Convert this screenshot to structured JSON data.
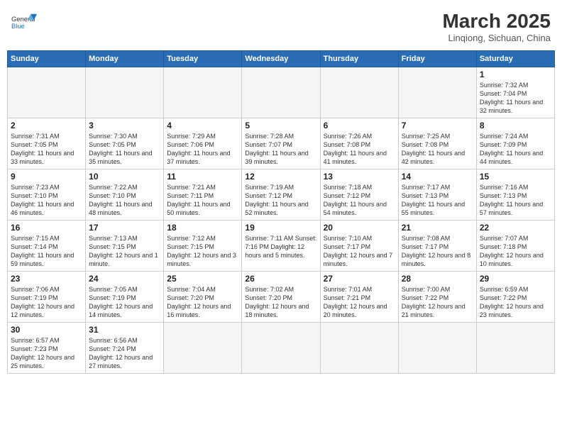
{
  "header": {
    "logo_general": "General",
    "logo_blue": "Blue",
    "month_year": "March 2025",
    "location": "Linqiong, Sichuan, China"
  },
  "days_of_week": [
    "Sunday",
    "Monday",
    "Tuesday",
    "Wednesday",
    "Thursday",
    "Friday",
    "Saturday"
  ],
  "weeks": [
    [
      {
        "num": "",
        "info": ""
      },
      {
        "num": "",
        "info": ""
      },
      {
        "num": "",
        "info": ""
      },
      {
        "num": "",
        "info": ""
      },
      {
        "num": "",
        "info": ""
      },
      {
        "num": "",
        "info": ""
      },
      {
        "num": "1",
        "info": "Sunrise: 7:32 AM\nSunset: 7:04 PM\nDaylight: 11 hours and 32 minutes."
      }
    ],
    [
      {
        "num": "2",
        "info": "Sunrise: 7:31 AM\nSunset: 7:05 PM\nDaylight: 11 hours and 33 minutes."
      },
      {
        "num": "3",
        "info": "Sunrise: 7:30 AM\nSunset: 7:05 PM\nDaylight: 11 hours and 35 minutes."
      },
      {
        "num": "4",
        "info": "Sunrise: 7:29 AM\nSunset: 7:06 PM\nDaylight: 11 hours and 37 minutes."
      },
      {
        "num": "5",
        "info": "Sunrise: 7:28 AM\nSunset: 7:07 PM\nDaylight: 11 hours and 39 minutes."
      },
      {
        "num": "6",
        "info": "Sunrise: 7:26 AM\nSunset: 7:08 PM\nDaylight: 11 hours and 41 minutes."
      },
      {
        "num": "7",
        "info": "Sunrise: 7:25 AM\nSunset: 7:08 PM\nDaylight: 11 hours and 42 minutes."
      },
      {
        "num": "8",
        "info": "Sunrise: 7:24 AM\nSunset: 7:09 PM\nDaylight: 11 hours and 44 minutes."
      }
    ],
    [
      {
        "num": "9",
        "info": "Sunrise: 7:23 AM\nSunset: 7:10 PM\nDaylight: 11 hours and 46 minutes."
      },
      {
        "num": "10",
        "info": "Sunrise: 7:22 AM\nSunset: 7:10 PM\nDaylight: 11 hours and 48 minutes."
      },
      {
        "num": "11",
        "info": "Sunrise: 7:21 AM\nSunset: 7:11 PM\nDaylight: 11 hours and 50 minutes."
      },
      {
        "num": "12",
        "info": "Sunrise: 7:19 AM\nSunset: 7:12 PM\nDaylight: 11 hours and 52 minutes."
      },
      {
        "num": "13",
        "info": "Sunrise: 7:18 AM\nSunset: 7:12 PM\nDaylight: 11 hours and 54 minutes."
      },
      {
        "num": "14",
        "info": "Sunrise: 7:17 AM\nSunset: 7:13 PM\nDaylight: 11 hours and 55 minutes."
      },
      {
        "num": "15",
        "info": "Sunrise: 7:16 AM\nSunset: 7:13 PM\nDaylight: 11 hours and 57 minutes."
      }
    ],
    [
      {
        "num": "16",
        "info": "Sunrise: 7:15 AM\nSunset: 7:14 PM\nDaylight: 11 hours and 59 minutes."
      },
      {
        "num": "17",
        "info": "Sunrise: 7:13 AM\nSunset: 7:15 PM\nDaylight: 12 hours and 1 minute."
      },
      {
        "num": "18",
        "info": "Sunrise: 7:12 AM\nSunset: 7:15 PM\nDaylight: 12 hours and 3 minutes."
      },
      {
        "num": "19",
        "info": "Sunrise: 7:11 AM\nSunset: 7:16 PM\nDaylight: 12 hours and 5 minutes."
      },
      {
        "num": "20",
        "info": "Sunrise: 7:10 AM\nSunset: 7:17 PM\nDaylight: 12 hours and 7 minutes."
      },
      {
        "num": "21",
        "info": "Sunrise: 7:08 AM\nSunset: 7:17 PM\nDaylight: 12 hours and 8 minutes."
      },
      {
        "num": "22",
        "info": "Sunrise: 7:07 AM\nSunset: 7:18 PM\nDaylight: 12 hours and 10 minutes."
      }
    ],
    [
      {
        "num": "23",
        "info": "Sunrise: 7:06 AM\nSunset: 7:19 PM\nDaylight: 12 hours and 12 minutes."
      },
      {
        "num": "24",
        "info": "Sunrise: 7:05 AM\nSunset: 7:19 PM\nDaylight: 12 hours and 14 minutes."
      },
      {
        "num": "25",
        "info": "Sunrise: 7:04 AM\nSunset: 7:20 PM\nDaylight: 12 hours and 16 minutes."
      },
      {
        "num": "26",
        "info": "Sunrise: 7:02 AM\nSunset: 7:20 PM\nDaylight: 12 hours and 18 minutes."
      },
      {
        "num": "27",
        "info": "Sunrise: 7:01 AM\nSunset: 7:21 PM\nDaylight: 12 hours and 20 minutes."
      },
      {
        "num": "28",
        "info": "Sunrise: 7:00 AM\nSunset: 7:22 PM\nDaylight: 12 hours and 21 minutes."
      },
      {
        "num": "29",
        "info": "Sunrise: 6:59 AM\nSunset: 7:22 PM\nDaylight: 12 hours and 23 minutes."
      }
    ],
    [
      {
        "num": "30",
        "info": "Sunrise: 6:57 AM\nSunset: 7:23 PM\nDaylight: 12 hours and 25 minutes."
      },
      {
        "num": "31",
        "info": "Sunrise: 6:56 AM\nSunset: 7:24 PM\nDaylight: 12 hours and 27 minutes."
      },
      {
        "num": "",
        "info": ""
      },
      {
        "num": "",
        "info": ""
      },
      {
        "num": "",
        "info": ""
      },
      {
        "num": "",
        "info": ""
      },
      {
        "num": "",
        "info": ""
      }
    ]
  ]
}
